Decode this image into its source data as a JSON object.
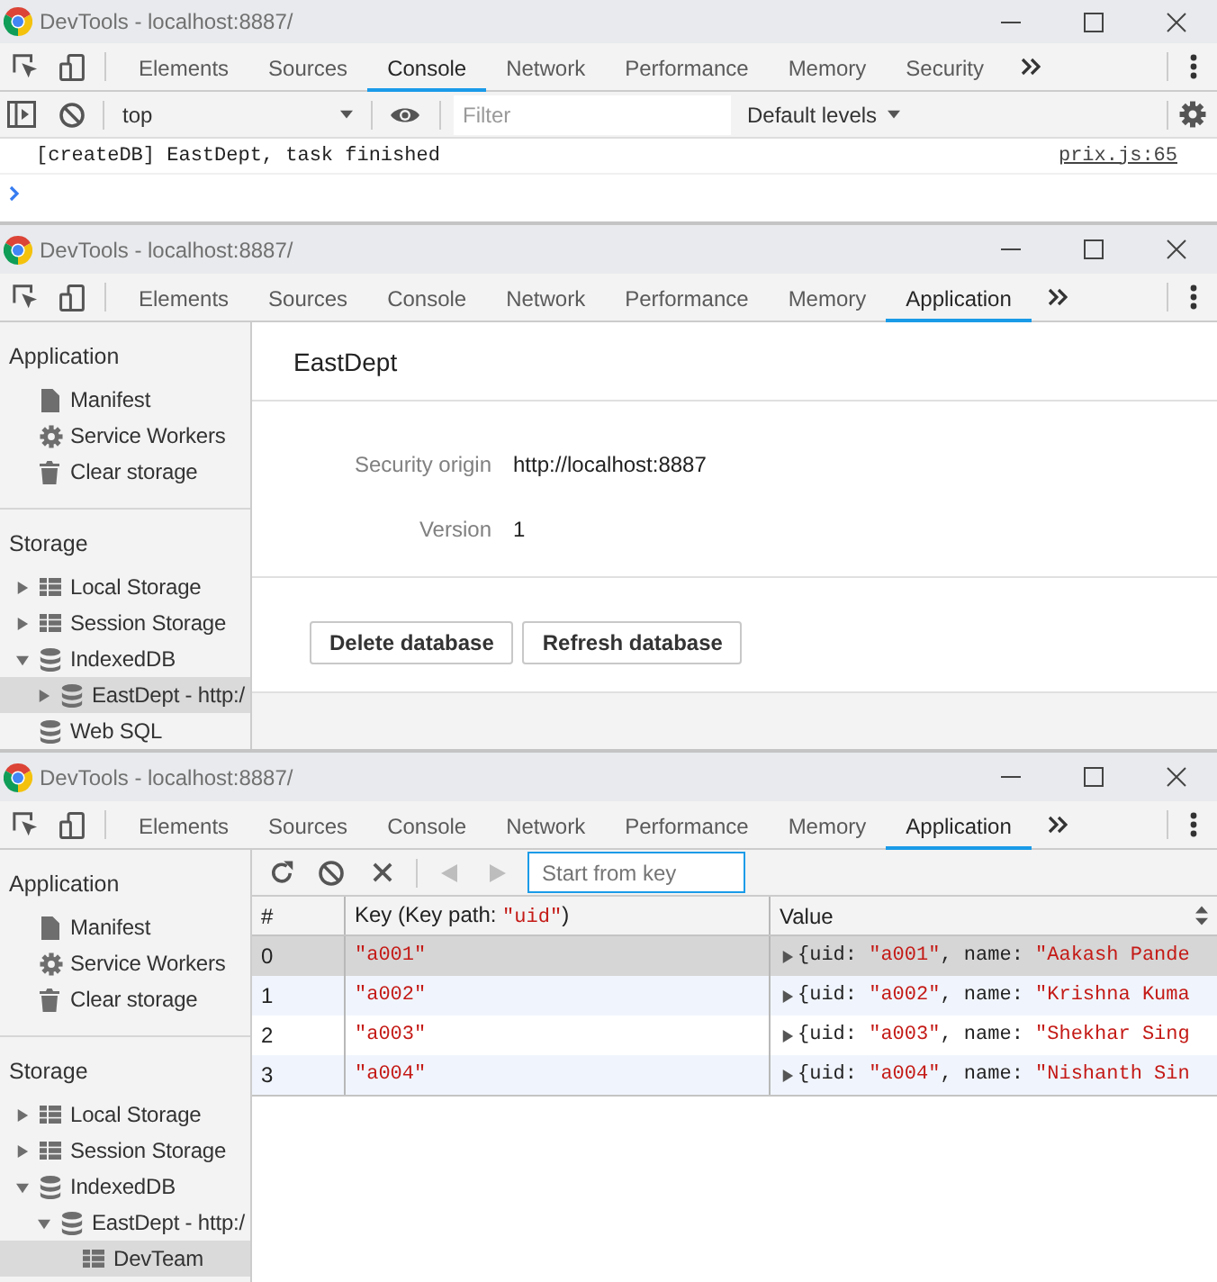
{
  "windows": [
    {
      "title": "DevTools - localhost:8887/",
      "tabs": [
        {
          "label": "Elements",
          "selected": false
        },
        {
          "label": "Sources",
          "selected": false
        },
        {
          "label": "Console",
          "selected": true
        },
        {
          "label": "Network",
          "selected": false
        },
        {
          "label": "Performance",
          "selected": false
        },
        {
          "label": "Memory",
          "selected": false
        },
        {
          "label": "Security",
          "selected": false
        }
      ],
      "panel": {
        "kind": "console",
        "context": "top",
        "filter": {
          "placeholder": "Filter"
        },
        "levels": "Default levels",
        "messages": [
          {
            "text": "[createDB] EastDept, task finished",
            "source": "prix.js:65"
          }
        ]
      }
    },
    {
      "title": "DevTools - localhost:8887/",
      "tabs": [
        {
          "label": "Elements",
          "selected": false
        },
        {
          "label": "Sources",
          "selected": false
        },
        {
          "label": "Console",
          "selected": false
        },
        {
          "label": "Network",
          "selected": false
        },
        {
          "label": "Performance",
          "selected": false
        },
        {
          "label": "Memory",
          "selected": false
        },
        {
          "label": "Application",
          "selected": true
        }
      ],
      "panel": {
        "kind": "application",
        "sidebar": [
          {
            "title": "Application",
            "items": [
              {
                "label": "Manifest",
                "kind": "manifest",
                "selected": false
              },
              {
                "label": "Service Workers",
                "kind": "workers",
                "selected": false
              },
              {
                "label": "Clear storage",
                "kind": "clear",
                "selected": false
              }
            ]
          },
          {
            "title": "Storage",
            "items": [
              {
                "label": "Local Storage",
                "kind": "table",
                "expanded": false,
                "selected": false
              },
              {
                "label": "Session Storage",
                "kind": "table",
                "expanded": false,
                "selected": false
              },
              {
                "label": "IndexedDB",
                "kind": "database",
                "expanded": true,
                "selected": false,
                "children": [
                  {
                    "label": "EastDept - http:/",
                    "kind": "database",
                    "expanded": false,
                    "selected": true
                  }
                ]
              },
              {
                "label": "Web SQL",
                "kind": "database",
                "selected": false
              }
            ]
          }
        ],
        "view": {
          "kind": "database",
          "name": "EastDept",
          "fields": [
            {
              "label": "Security origin",
              "value": "http://localhost:8887"
            },
            {
              "label": "Version",
              "value": "1"
            }
          ],
          "buttons": [
            {
              "label": "Delete database"
            },
            {
              "label": "Refresh database"
            }
          ]
        }
      }
    },
    {
      "title": "DevTools - localhost:8887/",
      "tabs": [
        {
          "label": "Elements",
          "selected": false
        },
        {
          "label": "Sources",
          "selected": false
        },
        {
          "label": "Console",
          "selected": false
        },
        {
          "label": "Network",
          "selected": false
        },
        {
          "label": "Performance",
          "selected": false
        },
        {
          "label": "Memory",
          "selected": false
        },
        {
          "label": "Application",
          "selected": true
        }
      ],
      "panel": {
        "kind": "application",
        "sidebar": [
          {
            "title": "Application",
            "items": [
              {
                "label": "Manifest",
                "kind": "manifest",
                "selected": false
              },
              {
                "label": "Service Workers",
                "kind": "workers",
                "selected": false
              },
              {
                "label": "Clear storage",
                "kind": "clear",
                "selected": false
              }
            ]
          },
          {
            "title": "Storage",
            "items": [
              {
                "label": "Local Storage",
                "kind": "table",
                "expanded": false,
                "selected": false
              },
              {
                "label": "Session Storage",
                "kind": "table",
                "expanded": false,
                "selected": false
              },
              {
                "label": "IndexedDB",
                "kind": "database",
                "expanded": true,
                "selected": false,
                "children": [
                  {
                    "label": "EastDept - http:/",
                    "kind": "database",
                    "expanded": true,
                    "selected": false,
                    "children": [
                      {
                        "label": "DevTeam",
                        "kind": "table",
                        "selected": true
                      }
                    ]
                  }
                ]
              }
            ]
          }
        ],
        "view": {
          "kind": "object_store",
          "search": {
            "placeholder": "Start from key",
            "focused": true
          },
          "prev_disabled": true,
          "next_disabled": true,
          "columns": [
            {
              "parts": [
                {
                  "text": "#",
                  "kind": "plain"
                }
              ]
            },
            {
              "parts": [
                {
                  "text": "Key (Key path: ",
                  "kind": "plain"
                },
                {
                  "text": "\"uid\"",
                  "kind": "string"
                },
                {
                  "text": ")",
                  "kind": "plain"
                }
              ]
            },
            {
              "parts": [
                {
                  "text": "Value",
                  "kind": "plain"
                }
              ],
              "sortable": true
            }
          ],
          "rows": [
            {
              "index": "0",
              "key": "\"a001\"",
              "expanded": false,
              "value": [
                {
                  "text": "{uid: ",
                  "kind": "plain"
                },
                {
                  "text": "\"a001\"",
                  "kind": "string"
                },
                {
                  "text": ", name: ",
                  "kind": "plain"
                },
                {
                  "text": "\"Aakash Pande",
                  "kind": "string"
                }
              ],
              "selected": true
            },
            {
              "index": "1",
              "key": "\"a002\"",
              "expanded": false,
              "value": [
                {
                  "text": "{uid: ",
                  "kind": "plain"
                },
                {
                  "text": "\"a002\"",
                  "kind": "string"
                },
                {
                  "text": ", name: ",
                  "kind": "plain"
                },
                {
                  "text": "\"Krishna Kuma",
                  "kind": "string"
                }
              ],
              "selected": false
            },
            {
              "index": "2",
              "key": "\"a003\"",
              "expanded": false,
              "value": [
                {
                  "text": "{uid: ",
                  "kind": "plain"
                },
                {
                  "text": "\"a003\"",
                  "kind": "string"
                },
                {
                  "text": ", name: ",
                  "kind": "plain"
                },
                {
                  "text": "\"Shekhar Sing",
                  "kind": "string"
                }
              ],
              "selected": false
            },
            {
              "index": "3",
              "key": "\"a004\"",
              "expanded": false,
              "value": [
                {
                  "text": "{uid: ",
                  "kind": "plain"
                },
                {
                  "text": "\"a004\"",
                  "kind": "string"
                },
                {
                  "text": ", name: ",
                  "kind": "plain"
                },
                {
                  "text": "\"Nishanth Sin",
                  "kind": "string"
                }
              ],
              "selected": false
            }
          ]
        }
      }
    }
  ]
}
